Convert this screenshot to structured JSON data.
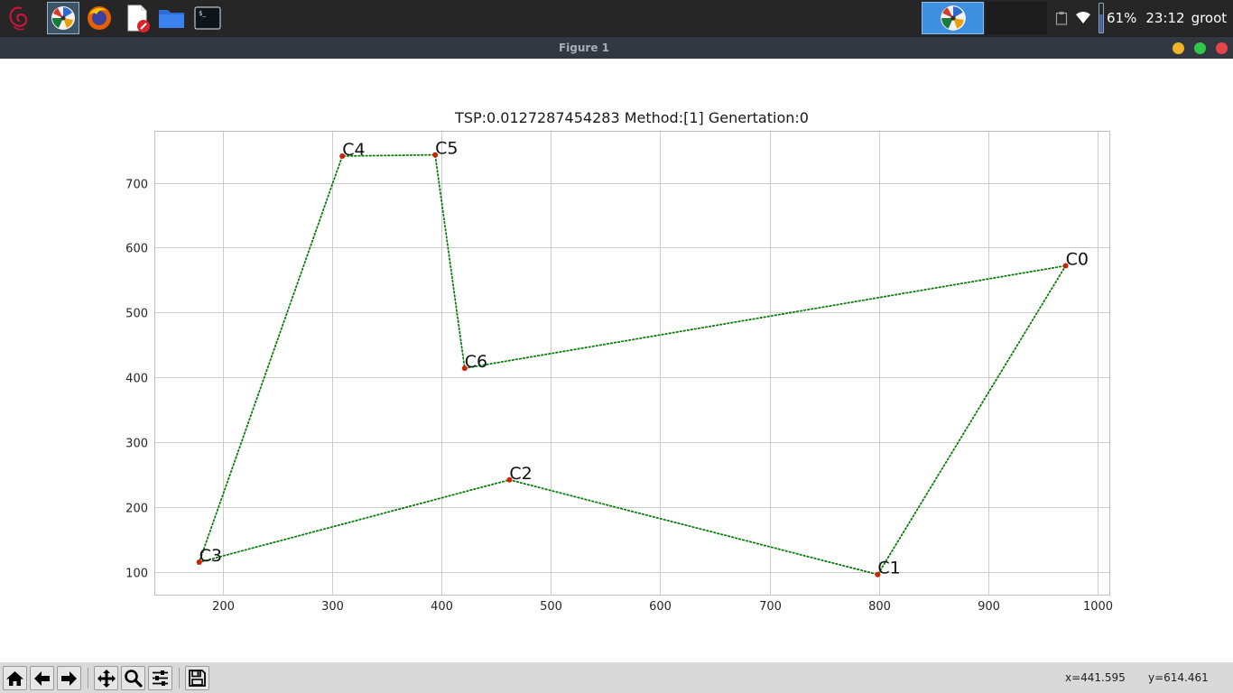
{
  "taskbar": {
    "apps": [
      {
        "icon": "debian-menu-icon"
      },
      {
        "icon": "python-figure-icon",
        "active": true
      },
      {
        "icon": "firefox-icon"
      },
      {
        "icon": "text-editor-icon"
      },
      {
        "icon": "file-manager-icon"
      },
      {
        "icon": "terminal-icon"
      }
    ],
    "battery_percent": "61%",
    "clock": "23:12",
    "user": "groot",
    "colors": {
      "bg": "#262626",
      "active_task": "#3d8fe0"
    }
  },
  "window": {
    "title": "Figure 1",
    "buttons": [
      {
        "name": "minimize",
        "color": "#f0b429"
      },
      {
        "name": "maximize",
        "color": "#2fc84a"
      },
      {
        "name": "close",
        "color": "#e8454a"
      }
    ]
  },
  "chart_data": {
    "type": "scatter",
    "title": "TSP:0.0127287454283  Method:[1]  Genertation:0",
    "xlabel": "",
    "ylabel": "",
    "xlim": [
      137,
      1011
    ],
    "ylim": [
      65,
      780
    ],
    "xticks": [
      200,
      300,
      400,
      500,
      600,
      700,
      800,
      900,
      1000
    ],
    "yticks": [
      100,
      200,
      300,
      400,
      500,
      600,
      700
    ],
    "grid": true,
    "points": [
      {
        "label": "C0",
        "x": 971,
        "y": 572
      },
      {
        "label": "C1",
        "x": 799,
        "y": 96
      },
      {
        "label": "C2",
        "x": 462,
        "y": 242
      },
      {
        "label": "C3",
        "x": 178,
        "y": 115
      },
      {
        "label": "C4",
        "x": 309,
        "y": 741
      },
      {
        "label": "C5",
        "x": 394,
        "y": 743
      },
      {
        "label": "C6",
        "x": 421,
        "y": 414
      }
    ],
    "route": [
      "C0",
      "C1",
      "C2",
      "C3",
      "C4",
      "C5",
      "C6",
      "C0"
    ],
    "colors": {
      "point": "#cc2200",
      "route": "#0a7d0a",
      "grid": "#cccccc"
    }
  },
  "toolbar": {
    "tools": [
      {
        "icon": "home-icon"
      },
      {
        "icon": "back-arrow-icon"
      },
      {
        "icon": "forward-arrow-icon"
      },
      {
        "icon": "pan-icon"
      },
      {
        "icon": "zoom-icon"
      },
      {
        "icon": "subplots-config-icon"
      },
      {
        "icon": "save-icon"
      }
    ],
    "coord_x": "x=441.595",
    "coord_y": "y=614.461"
  }
}
